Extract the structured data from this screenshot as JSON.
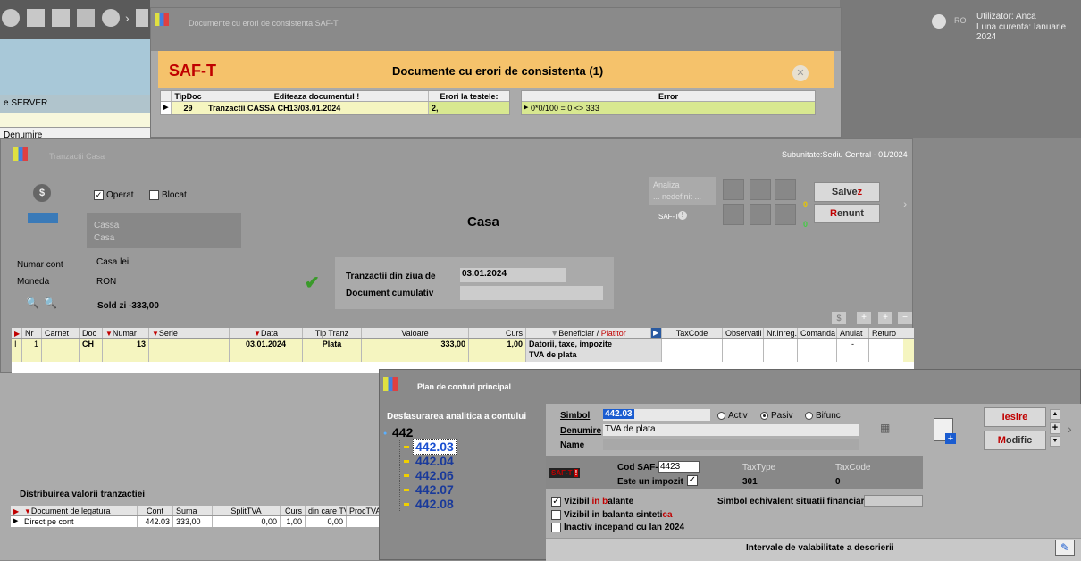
{
  "colors": {
    "accent": "#f5c26b",
    "saf_red": "#c00000",
    "link_blue": "#1a4fd0",
    "grid_yellow": "#f5f5c0",
    "select": "#d8e890"
  },
  "app": {
    "user_label": "Utilizator: Anca",
    "period_label": "Luna curenta: Ianuarie 2024",
    "lang": "RO"
  },
  "bg": {
    "server": "e SERVER",
    "denumire": "Denumire"
  },
  "saft": {
    "window_title": "Documente cu erori de consistenta SAF-T",
    "logo": "SAF-T",
    "heading": "Documente cu erori de consistenta (1)",
    "cols": {
      "tipdoc": "TipDoc",
      "edit": "Editeaza documentul !",
      "erori": "Erori la testele:",
      "error": "Error"
    },
    "row": {
      "tipdoc": "29",
      "doc": "Tranzactii CASSA CH13/03.01.2024",
      "erori": "2,",
      "error": "0*0/100 = 0 <> 333"
    }
  },
  "casa": {
    "window_title": "Tranzactii Casa",
    "subunit": "Subunitate:Sediu Central - 01/2024",
    "operat": "Operat",
    "blocat": "Blocat",
    "cassa1": "Cassa",
    "cassa2": "Casa",
    "title": "Casa",
    "analiza1": "Analiza",
    "analiza2": "... nedefinit ...",
    "saft_label": "SAF-T",
    "zero1": "0",
    "zero2": "0",
    "salvez": "Salve",
    "salvez_u": "z",
    "renunt_u": "R",
    "renunt": "enunt",
    "numar_cont_lbl": "Numar cont",
    "numar_cont_val": "Casa lei",
    "moneda_lbl": "Moneda",
    "moneda_val": "RON",
    "sold": "Sold zi -333,00",
    "tranz_lbl": "Tranzactii din ziua de",
    "tranz_val": "03.01.2024",
    "doc_cum_lbl": "Document cumulativ",
    "grid": {
      "headers": {
        "nr": "Nr",
        "carnet": "Carnet",
        "doc": "Doc",
        "numar": "Numar",
        "serie": "Serie",
        "data": "Data",
        "tip": "Tip Tranz",
        "valoare": "Valoare",
        "curs": "Curs",
        "benef": "Beneficiar / ",
        "platitor": "Platitor",
        "taxcode": "TaxCode",
        "obs": "Observatii",
        "nrinreg": "Nr.inreg.",
        "comanda": "Comanda",
        "anulat": "Anulat",
        "retur": "Returo"
      },
      "row": {
        "nr": "1",
        "doc": "CH",
        "numar": "13",
        "data": "03.01.2024",
        "tip": "Plata",
        "valoare": "333,00",
        "curs": "1,00",
        "benef1": "Datorii, taxe, impozite",
        "benef2": "TVA de plata",
        "anulat": "-"
      }
    },
    "dist": {
      "title": "Distribuirea valorii tranzactiei",
      "headers": {
        "doc": "Document de legatura",
        "cont": "Cont",
        "suma": "Suma",
        "split": "SplitTVA",
        "curs": "Curs",
        "dincare": "din care TVA",
        "proc": "ProcTVA"
      },
      "row": {
        "doc": "Direct pe cont",
        "cont": "442.03",
        "suma": "333,00",
        "split": "0,00",
        "curs": "1,00",
        "dincare": "0,00"
      }
    }
  },
  "plan": {
    "window_title": "Plan de conturi principal",
    "tree_title": "Desfasurarea analitica a contului",
    "root": "442",
    "children": [
      "442.03",
      "442.04",
      "442.06",
      "442.07",
      "442.08"
    ],
    "selected": "442.03",
    "simbol_lbl": "Simbol",
    "simbol_val": "442.03",
    "denumire_lbl": "Denumire",
    "denumire_val": "TVA de plata",
    "name_lbl": "Name",
    "radio": [
      "Activ",
      "Pasiv",
      "Bifunc"
    ],
    "radio_selected": "Pasiv",
    "saft_badge": "SAF-T",
    "cod_saft_lbl": "Cod SAF-T",
    "cod_saft_val": "4423",
    "impozit_lbl": "Este un impozit",
    "taxtype_lbl": "TaxType",
    "taxtype_val": "301",
    "taxcode_lbl": "TaxCode",
    "taxcode_val": "0",
    "vizibil_a": "Vizibil ",
    "vizibil_b": "in b",
    "vizibil_c": "alante",
    "vizibil_sint_a": "Vizibil in balanta sinteti",
    "vizibil_sint_b": "ca",
    "inactiv": "Inactiv incepand cu Ian 2024",
    "echiv_lbl": "Simbol echivalent situatii financiare",
    "intervale": "Intervale de valabilitate a descrierii",
    "iesire": "Iesire",
    "modific_u": "M",
    "modific": "odific"
  }
}
